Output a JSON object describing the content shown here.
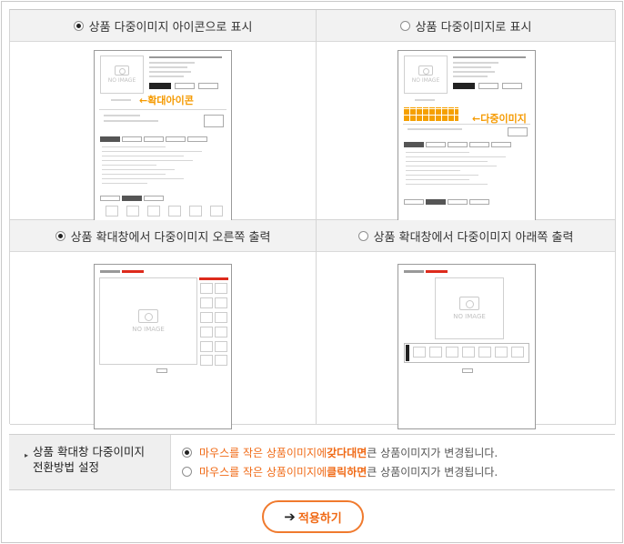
{
  "options": {
    "icon_display": {
      "label": "상품 다중이미지 아이콘으로 표시",
      "checked": true
    },
    "image_display": {
      "label": "상품 다중이미지로 표시",
      "checked": false
    },
    "zoom_right": {
      "label": "상품 확대창에서 다중이미지 오른쪽 출력",
      "checked": true
    },
    "zoom_below": {
      "label": "상품 확대창에서 다중이미지 아래쪽 출력",
      "checked": false
    }
  },
  "previews": {
    "icon_callout": "←확대아이콘",
    "multi_callout": "←다중이미지",
    "no_image": "NO IMAGE"
  },
  "settings": {
    "label_line1": "상품 확대창 다중이미지",
    "label_line2": "전환방법 설정",
    "hover": {
      "part1": "마우스를 작은 상품이미지에 ",
      "emph": "갖다대면",
      "part2": " 큰 상품이미지가 변경됩니다.",
      "checked": true
    },
    "click": {
      "part1": "마우스를 작은 상품이미지에 ",
      "emph": "클릭하면",
      "part2": " 큰 상품이미지가 변경됩니다.",
      "checked": false
    }
  },
  "apply_button": {
    "arrow": "➔",
    "label": "적용하기"
  },
  "colors": {
    "accent": "#f06a16",
    "callout": "#f59a00",
    "red": "#dd2a1c"
  }
}
